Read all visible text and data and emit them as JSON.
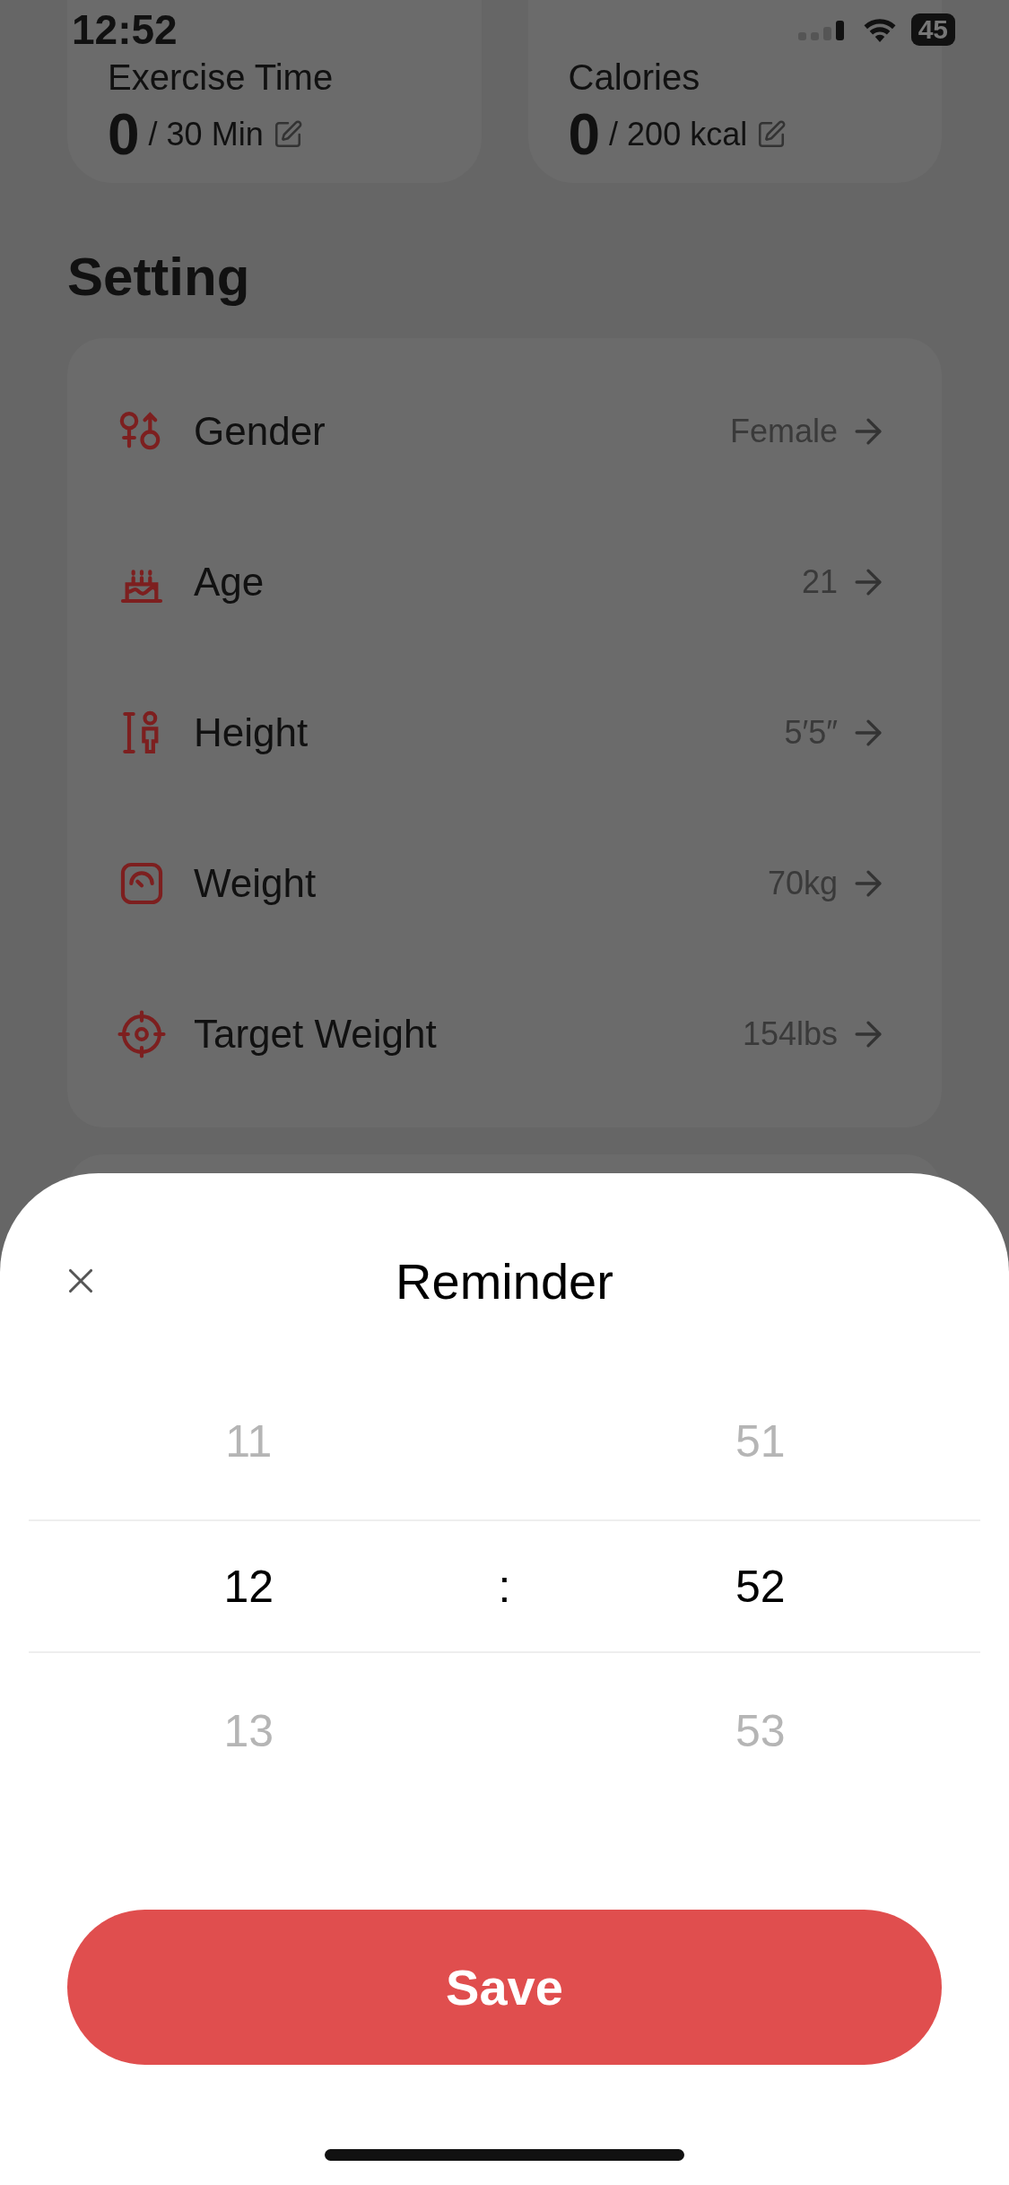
{
  "status_bar": {
    "time": "12:52",
    "battery": "45"
  },
  "goals": [
    {
      "title": "Exercise Time",
      "value": "0",
      "target": "/ 30 Min"
    },
    {
      "title": "Calories",
      "value": "0",
      "target": "/ 200 kcal"
    }
  ],
  "setting": {
    "title": "Setting",
    "items": [
      {
        "kind": "gender",
        "label": "Gender",
        "value": "Female"
      },
      {
        "kind": "age",
        "label": "Age",
        "value": "21"
      },
      {
        "kind": "height",
        "label": "Height",
        "value": "5′5″"
      },
      {
        "kind": "weight",
        "label": "Weight",
        "value": "70kg"
      },
      {
        "kind": "target",
        "label": "Target Weight",
        "value": "154lbs"
      }
    ]
  },
  "reminder": {
    "title": "Reminder",
    "separator": ":",
    "hours": [
      {
        "label": "11",
        "selected": false
      },
      {
        "label": "12",
        "selected": true
      },
      {
        "label": "13",
        "selected": false
      }
    ],
    "minutes": [
      {
        "label": "51",
        "selected": false
      },
      {
        "label": "52",
        "selected": true
      },
      {
        "label": "53",
        "selected": false
      }
    ],
    "save": "Save"
  }
}
